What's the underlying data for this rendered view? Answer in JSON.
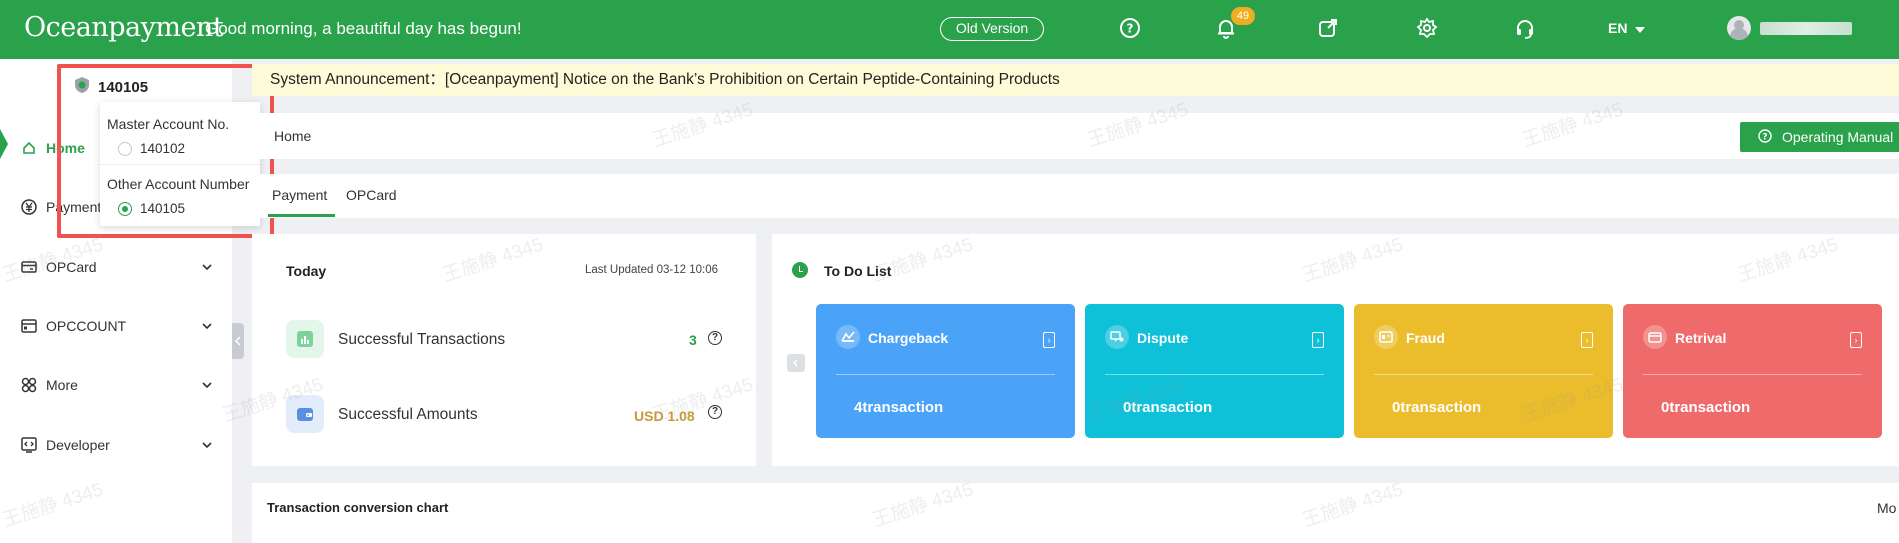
{
  "header": {
    "logo": "Oceanpayment",
    "greeting": "Good morning, a beautiful day has begun!",
    "old_version": "Old Version",
    "notification_count": "49",
    "language": "EN"
  },
  "account": {
    "current": "140105",
    "master_label": "Master Account No.",
    "master_number": "140102",
    "other_label": "Other Account Number",
    "other_number": "140105",
    "selected": "140105"
  },
  "sidebar": {
    "items": [
      {
        "label": "Home",
        "icon": "home-icon"
      },
      {
        "label": "Payment",
        "icon": "payment-icon"
      },
      {
        "label": "OPCard",
        "icon": "card-icon"
      },
      {
        "label": "OPCCOUNT",
        "icon": "account-icon"
      },
      {
        "label": "More",
        "icon": "grid-icon"
      },
      {
        "label": "Developer",
        "icon": "code-icon"
      }
    ]
  },
  "announcement": "System Announcement：[Oceanpayment] Notice on the Bank’s Prohibition on Certain Peptide-Containing Products",
  "breadcrumb": "Home",
  "operating_manual": "Operating Manual",
  "tabs": [
    {
      "label": "Payment",
      "active": true
    },
    {
      "label": "OPCard",
      "active": false
    }
  ],
  "today": {
    "title": "Today",
    "last_updated": "Last Updated 03-12 10:06",
    "stats": [
      {
        "label": "Successful Transactions",
        "value": "3",
        "color": "#2aa14b"
      },
      {
        "label": "Successful Amounts",
        "value": "USD 1.08",
        "color": "#c79a3a"
      }
    ]
  },
  "todo": {
    "title": "To Do List",
    "tiles": [
      {
        "title": "Chargeback",
        "count": "4transaction",
        "color": "#4aa3f7",
        "icon": "chargeback-icon"
      },
      {
        "title": "Dispute",
        "count": "0transaction",
        "color": "#0ec1d8",
        "icon": "dispute-icon"
      },
      {
        "title": "Fraud",
        "count": "0transaction",
        "color": "#ebbd2c",
        "icon": "fraud-icon"
      },
      {
        "title": "Retrival",
        "count": "0transaction",
        "color": "#ef6b6b",
        "icon": "retrival-icon"
      }
    ]
  },
  "chart_section": {
    "title": "Transaction conversion chart",
    "more": "Mo"
  },
  "watermark": "王施静 4345",
  "colors": {
    "brand_green": "#2aa14b",
    "announcement_bg": "#fdfbd8",
    "highlight_red": "#f0524f"
  }
}
